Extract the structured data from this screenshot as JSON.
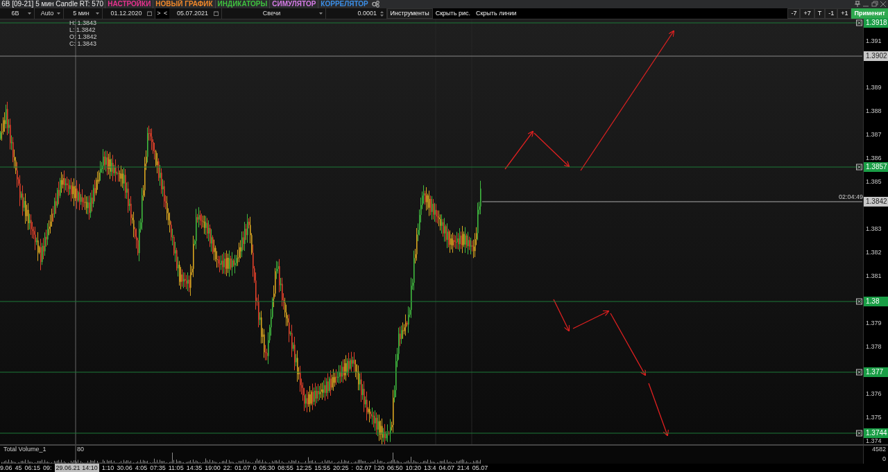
{
  "window": {
    "title": "6B [09-21] 5 мин Candle RT: 570"
  },
  "menu": [
    {
      "label": "НАСТРОЙКИ",
      "color": "#e8328f"
    },
    {
      "label": "НОВЫЙ ГРАФИК",
      "color": "#f0882a"
    },
    {
      "label": "ИНДИКАТОРЫ",
      "color": "#3fc23f"
    },
    {
      "label": "СИМУЛЯТОР",
      "color": "#d77ce8"
    },
    {
      "label": "КОРРЕЛЯТОР",
      "color": "#3b8fe8"
    }
  ],
  "toolbar": {
    "symbol": "6B",
    "scale": "Auto",
    "timeframe": "5 мин",
    "date_from": "01.12.2020",
    "next": ">",
    "prev": "<",
    "date_to": "05.07.2021",
    "chart_type": "Свечи",
    "step": "0.0001",
    "buttons": [
      "Инструменты",
      "Скрыть рис.",
      "Скрыть линии"
    ],
    "shift_buttons": [
      "-7",
      "+7",
      "T",
      "-1",
      "+1"
    ],
    "apply": "Применит"
  },
  "ohlc": [
    "H: 1.3843",
    "L: 1.3842",
    "O: 1.3842",
    "C: 1.3843"
  ],
  "price_axis": [
    "1.391",
    "1.389",
    "1.388",
    "1.387",
    "1.386",
    "1.385",
    "1.383",
    "1.382",
    "1.381",
    "1.379",
    "1.378",
    "1.376",
    "1.375",
    "1.374"
  ],
  "lines": [
    {
      "label": "1.3918",
      "kind": "level"
    },
    {
      "label": "1.3902",
      "kind": "grey"
    },
    {
      "label": "1.3857",
      "kind": "level"
    },
    {
      "label": "1.3842",
      "kind": "current"
    },
    {
      "label": "1.38",
      "kind": "level"
    },
    {
      "label": "1.377",
      "kind": "level"
    },
    {
      "label": "1.3744",
      "kind": "level"
    }
  ],
  "countdown": "02:04:49",
  "volume": {
    "title": "Total Volume_1",
    "cursor_value": "80",
    "max": "4582",
    "min": "0"
  },
  "time_axis": [
    {
      "label": "9.06",
      "selected": false
    },
    {
      "label": "45",
      "selected": false
    },
    {
      "label": "06:15",
      "selected": false
    },
    {
      "label": "09:",
      "selected": false
    },
    {
      "label": "29.06.21 14:10",
      "selected": true
    },
    {
      "label": "1:10",
      "selected": false
    },
    {
      "label": "30.06",
      "selected": false
    },
    {
      "label": "4:05",
      "selected": false
    },
    {
      "label": "07:35",
      "selected": false
    },
    {
      "label": "11:05",
      "selected": false
    },
    {
      "label": "14:35",
      "selected": false
    },
    {
      "label": "19:00",
      "selected": false
    },
    {
      "label": "22:",
      "selected": false
    },
    {
      "label": "01.07",
      "selected": false
    },
    {
      "label": "0",
      "selected": false
    },
    {
      "label": "05:30",
      "selected": false
    },
    {
      "label": "08:55",
      "selected": false
    },
    {
      "label": "12:25",
      "selected": false
    },
    {
      "label": "15:55",
      "selected": false
    },
    {
      "label": "20:25",
      "selected": false
    },
    {
      "label": ":",
      "selected": false
    },
    {
      "label": "02.07",
      "selected": false
    },
    {
      "label": "l:20",
      "selected": false
    },
    {
      "label": "06:50",
      "selected": false
    },
    {
      "label": "10:20",
      "selected": false
    },
    {
      "label": "13:4",
      "selected": false
    },
    {
      "label": "04.07",
      "selected": false
    },
    {
      "label": "21:4",
      "selected": false
    },
    {
      "label": "05.07",
      "selected": false
    }
  ]
}
